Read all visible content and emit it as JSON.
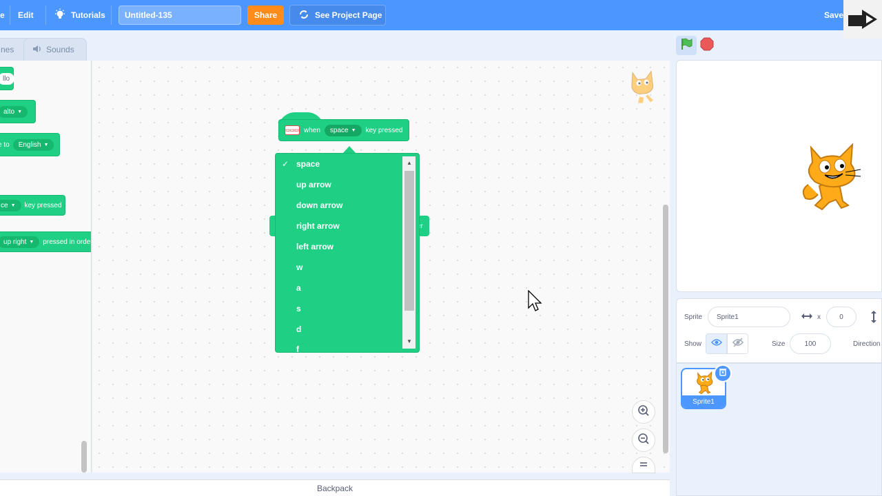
{
  "menu": {
    "file_partial": "e",
    "edit_label": "Edit",
    "tutorials_label": "Tutorials",
    "project_title": "Untitled-135",
    "share_label": "Share",
    "see_project_label": "See Project Page",
    "save_label": "Save"
  },
  "tabs": {
    "costumes_partial": "nes",
    "sounds_label": "Sounds"
  },
  "palette": {
    "blocks": [
      {
        "text": "llo"
      },
      {
        "pill": "alto"
      },
      {
        "prefix": "e to",
        "pill": "English"
      },
      {
        "pill": "ce",
        "suffix": "key pressed"
      },
      {
        "pill": "up right",
        "suffix": "pressed in order"
      }
    ]
  },
  "script": {
    "when_label": "when",
    "key_value": "space",
    "key_pressed_label": "key pressed",
    "ext_icon_text": "▭▭▭",
    "ghost_right_text": "er"
  },
  "dropdown": {
    "selected": "space",
    "items": [
      "space",
      "up arrow",
      "down arrow",
      "right arrow",
      "left arrow",
      "w",
      "a",
      "s",
      "d",
      "f"
    ]
  },
  "backpack_label": "Backpack",
  "sprite_info": {
    "sprite_label": "Sprite",
    "sprite_name": "Sprite1",
    "x_label": "x",
    "x_value": "0",
    "show_label": "Show",
    "size_label": "Size",
    "size_value": "100",
    "direction_label": "Direction"
  },
  "sprites": [
    {
      "name": "Sprite1",
      "selected": true
    }
  ],
  "colors": {
    "menu_bar": "#4c97ff",
    "share": "#ff8c1a",
    "extension_block": "#1fcf84",
    "stop": "#ec5959",
    "flag": "#2fb65a"
  },
  "icons": [
    "tutorials-bulb-icon",
    "remix-arrows-icon",
    "speaker-icon",
    "green-flag-icon",
    "stop-icon",
    "zoom-in-icon",
    "zoom-out-icon",
    "zoom-reset-icon",
    "eye-icon",
    "eye-hidden-icon",
    "trash-icon",
    "horizontal-arrows-icon",
    "vertical-arrows-icon"
  ]
}
